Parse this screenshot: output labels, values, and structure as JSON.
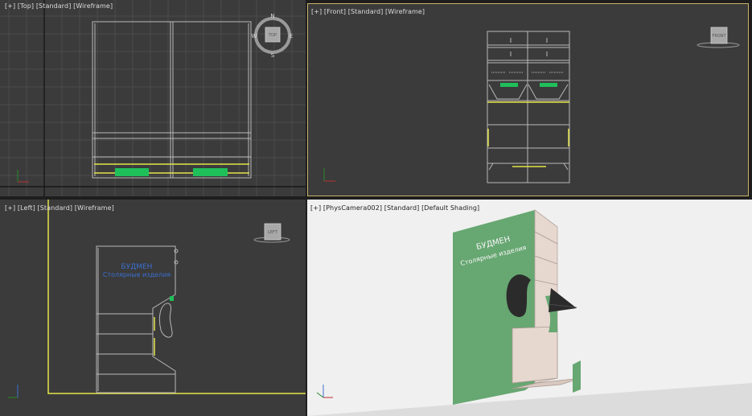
{
  "viewports": [
    {
      "id": "top",
      "plus": "[+]",
      "view": "[Top]",
      "mode": "[Standard]",
      "shading": "[Wireframe]",
      "cube_label": "TOP",
      "compass": {
        "n": "N",
        "s": "S",
        "e": "E",
        "w": "W"
      }
    },
    {
      "id": "front",
      "plus": "[+]",
      "view": "[Front]",
      "mode": "[Standard]",
      "shading": "[Wireframe]",
      "cube_label": "FRONT"
    },
    {
      "id": "left",
      "plus": "[+]",
      "view": "[Left]",
      "mode": "[Standard]",
      "shading": "[Wireframe]",
      "cube_label": "LEFT",
      "sign_line1": "БУДМЕН",
      "sign_line2": "Столярные изделия"
    },
    {
      "id": "persp",
      "plus": "[+]",
      "view": "[PhysCamera002]",
      "mode": "[Standard]",
      "shading": "[Default Shading]",
      "sign_line1": "БУДМЕН",
      "sign_line2": "Столярные изделия"
    }
  ],
  "colors": {
    "viewport_bg": "#3b3b3b",
    "grid": "#4a4a4a",
    "wire": "#b8b8b8",
    "highlight": "#e4e44a",
    "green": "#1fbf5a",
    "active_border": "#c9b26a",
    "persp_bg": "#f2f2f2",
    "panel_green": "#67a772",
    "wood": "#e6d7cf"
  }
}
